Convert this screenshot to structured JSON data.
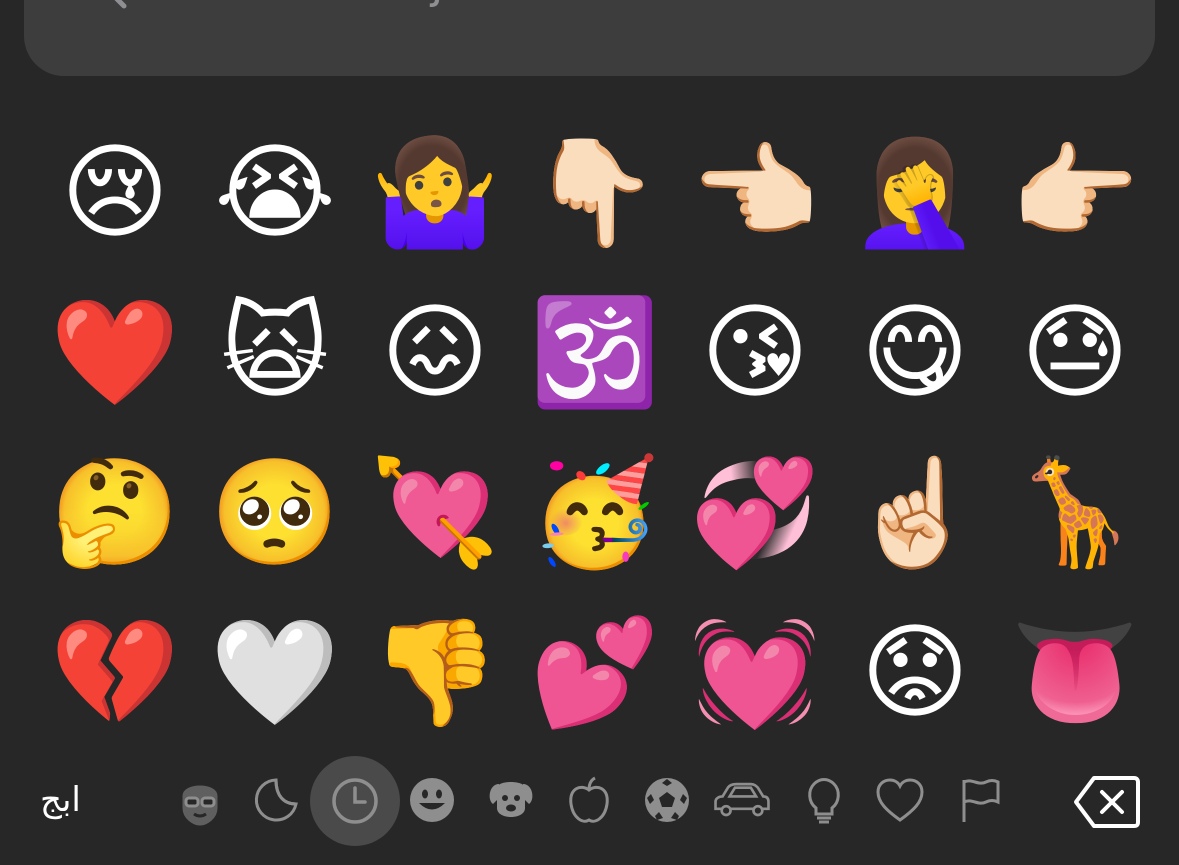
{
  "search": {
    "placeholder": "Search Emoji",
    "icon": "search-icon"
  },
  "emoji_grid": [
    {
      "name": "crying-face",
      "char": "😢"
    },
    {
      "name": "loudly-crying-face",
      "char": "😭"
    },
    {
      "name": "memoji-shrug",
      "char": "🤷‍♀️"
    },
    {
      "name": "pointing-down",
      "char": "👇🏻"
    },
    {
      "name": "pointing-left",
      "char": "👈🏻"
    },
    {
      "name": "memoji-facepalm",
      "char": "🤦‍♀️"
    },
    {
      "name": "pointing-right",
      "char": "👉🏻"
    },
    {
      "name": "red-heart",
      "char": "❤️"
    },
    {
      "name": "weary-cat",
      "char": "🙀"
    },
    {
      "name": "confounded-face",
      "char": "😖"
    },
    {
      "name": "om-symbol",
      "char": "🕉️"
    },
    {
      "name": "memoji-kiss",
      "char": "😘"
    },
    {
      "name": "face-savoring-food",
      "char": "😋"
    },
    {
      "name": "downcast-face-with-sweat",
      "char": "😓"
    },
    {
      "name": "memoji-thinking",
      "char": "🤔"
    },
    {
      "name": "pleading-face",
      "char": "🥺"
    },
    {
      "name": "heart-with-arrow",
      "char": "💘"
    },
    {
      "name": "memoji-party",
      "char": "🥳"
    },
    {
      "name": "revolving-hearts",
      "char": "💞"
    },
    {
      "name": "pointing-up",
      "char": "☝🏻"
    },
    {
      "name": "giraffe",
      "char": "🦒"
    },
    {
      "name": "broken-heart",
      "char": "💔"
    },
    {
      "name": "white-heart",
      "char": "🤍"
    },
    {
      "name": "memoji-thumbs-down",
      "char": "👎"
    },
    {
      "name": "two-hearts",
      "char": "💕"
    },
    {
      "name": "beating-heart",
      "char": "💓"
    },
    {
      "name": "memoji-sad",
      "char": "😟"
    },
    {
      "name": "tongue",
      "char": "👅"
    }
  ],
  "bottom_bar": {
    "keyboard_switch_label": "ابج",
    "categories": [
      "memoji-stickers-icon",
      "stickers-icon",
      "recents-icon",
      "smileys-icon",
      "animals-icon",
      "food-icon",
      "activity-icon",
      "travel-icon",
      "objects-icon",
      "symbols-icon",
      "flags-icon"
    ],
    "active_category": "recents-icon",
    "delete": "delete-icon"
  },
  "colors": {
    "background": "#272727",
    "search_bg": "#3d3d3d",
    "placeholder": "#8e8e93",
    "icon_gray": "#8e8e8e",
    "active_bg": "#4a4a4a"
  }
}
